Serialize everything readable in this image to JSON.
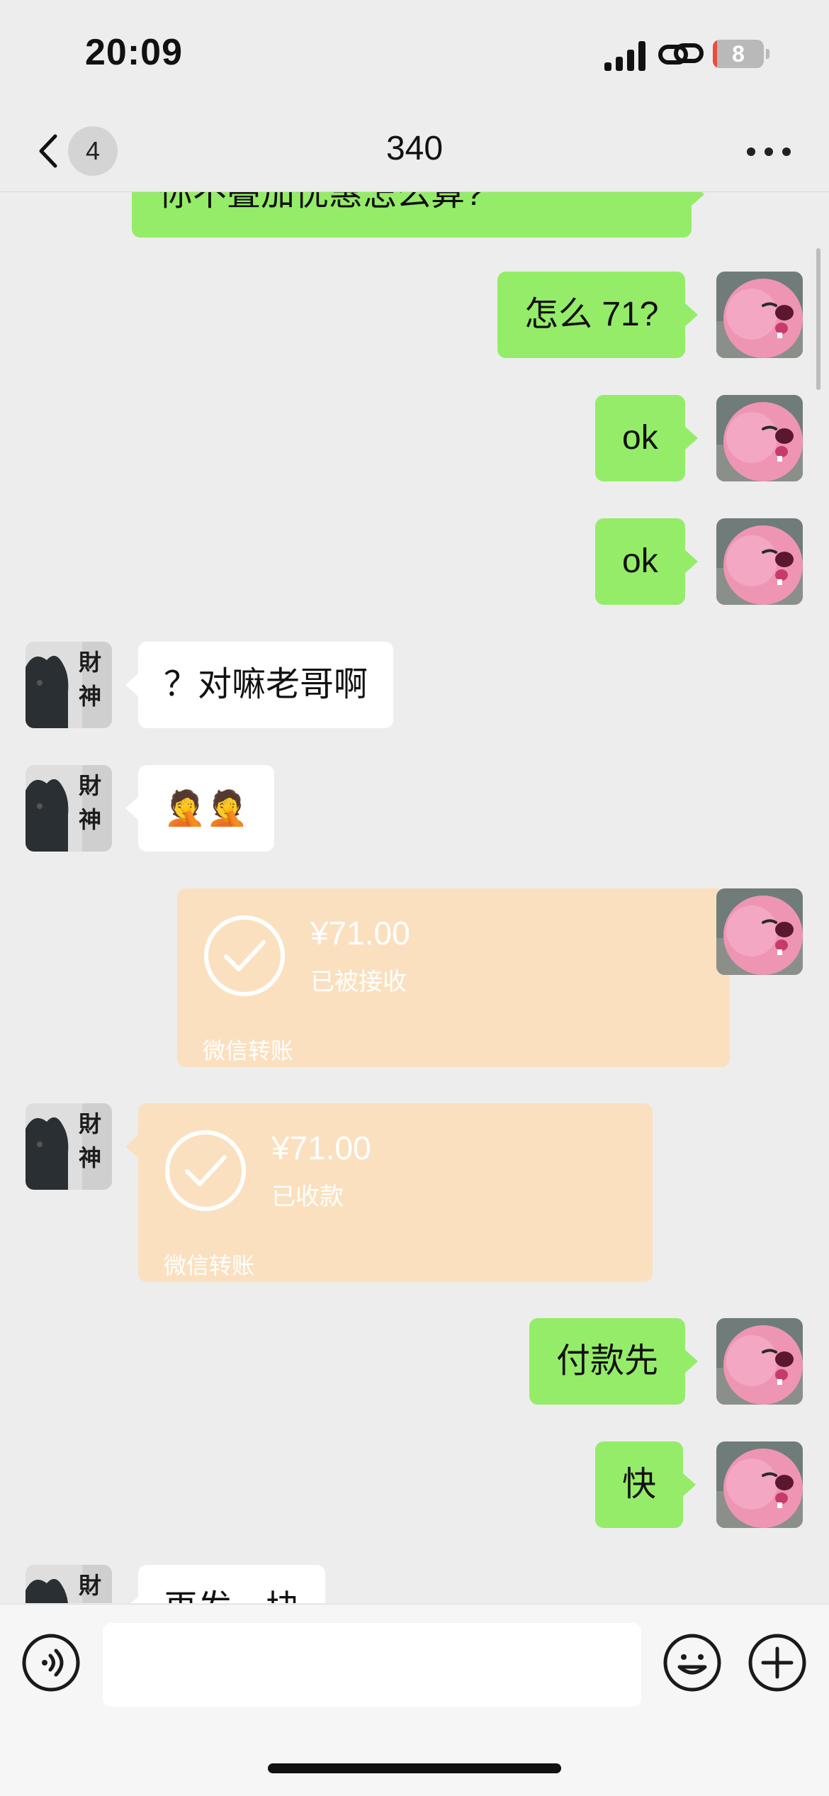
{
  "status_bar": {
    "time": "20:09",
    "battery_level": "8",
    "battery_fraction": 0.08
  },
  "nav": {
    "back_count": "4",
    "title": "340"
  },
  "messages": [
    {
      "side": "right",
      "type": "text",
      "text": "你不叠加优惠怎么算?"
    },
    {
      "side": "right",
      "type": "text",
      "text": "怎么 71?"
    },
    {
      "side": "right",
      "type": "text",
      "text": "ok"
    },
    {
      "side": "right",
      "type": "text",
      "text": "ok"
    },
    {
      "side": "left",
      "type": "text",
      "text": "？对嘛老哥啊"
    },
    {
      "side": "left",
      "type": "emoji",
      "text": "🤦🤦"
    },
    {
      "side": "right",
      "type": "transfer",
      "amount": "¥71.00",
      "status": "已被接收",
      "footer": "微信转账"
    },
    {
      "side": "left",
      "type": "transfer",
      "amount": "¥71.00",
      "status": "已收款",
      "footer": "微信转账"
    },
    {
      "side": "right",
      "type": "text",
      "text": "付款先"
    },
    {
      "side": "right",
      "type": "text",
      "text": "快"
    },
    {
      "side": "left",
      "type": "text",
      "text": "再发一块"
    }
  ],
  "input_bar": {
    "placeholder": ""
  },
  "colors": {
    "background": "#EDEDED",
    "bubble_sent": "#95EC69",
    "bubble_received": "#FFFFFF",
    "transfer_card": "#FBE0BF",
    "battery_low": "#E94B3C"
  },
  "icons": {
    "voice": "voice-icon",
    "emoji": "emoji-icon",
    "plus": "plus-icon",
    "back": "chevron-left-icon",
    "more": "more-icon"
  }
}
